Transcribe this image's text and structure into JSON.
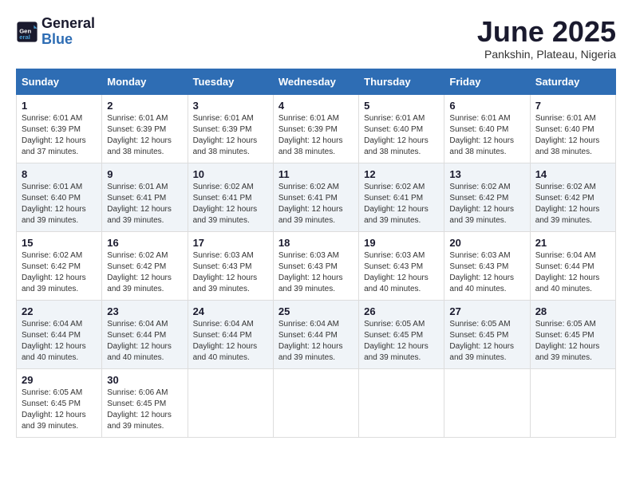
{
  "logo": {
    "line1": "General",
    "line2": "Blue"
  },
  "title": "June 2025",
  "subtitle": "Pankshin, Plateau, Nigeria",
  "weekdays": [
    "Sunday",
    "Monday",
    "Tuesday",
    "Wednesday",
    "Thursday",
    "Friday",
    "Saturday"
  ],
  "weeks": [
    [
      {
        "day": "1",
        "info": "Sunrise: 6:01 AM\nSunset: 6:39 PM\nDaylight: 12 hours\nand 37 minutes."
      },
      {
        "day": "2",
        "info": "Sunrise: 6:01 AM\nSunset: 6:39 PM\nDaylight: 12 hours\nand 38 minutes."
      },
      {
        "day": "3",
        "info": "Sunrise: 6:01 AM\nSunset: 6:39 PM\nDaylight: 12 hours\nand 38 minutes."
      },
      {
        "day": "4",
        "info": "Sunrise: 6:01 AM\nSunset: 6:39 PM\nDaylight: 12 hours\nand 38 minutes."
      },
      {
        "day": "5",
        "info": "Sunrise: 6:01 AM\nSunset: 6:40 PM\nDaylight: 12 hours\nand 38 minutes."
      },
      {
        "day": "6",
        "info": "Sunrise: 6:01 AM\nSunset: 6:40 PM\nDaylight: 12 hours\nand 38 minutes."
      },
      {
        "day": "7",
        "info": "Sunrise: 6:01 AM\nSunset: 6:40 PM\nDaylight: 12 hours\nand 38 minutes."
      }
    ],
    [
      {
        "day": "8",
        "info": "Sunrise: 6:01 AM\nSunset: 6:40 PM\nDaylight: 12 hours\nand 39 minutes."
      },
      {
        "day": "9",
        "info": "Sunrise: 6:01 AM\nSunset: 6:41 PM\nDaylight: 12 hours\nand 39 minutes."
      },
      {
        "day": "10",
        "info": "Sunrise: 6:02 AM\nSunset: 6:41 PM\nDaylight: 12 hours\nand 39 minutes."
      },
      {
        "day": "11",
        "info": "Sunrise: 6:02 AM\nSunset: 6:41 PM\nDaylight: 12 hours\nand 39 minutes."
      },
      {
        "day": "12",
        "info": "Sunrise: 6:02 AM\nSunset: 6:41 PM\nDaylight: 12 hours\nand 39 minutes."
      },
      {
        "day": "13",
        "info": "Sunrise: 6:02 AM\nSunset: 6:42 PM\nDaylight: 12 hours\nand 39 minutes."
      },
      {
        "day": "14",
        "info": "Sunrise: 6:02 AM\nSunset: 6:42 PM\nDaylight: 12 hours\nand 39 minutes."
      }
    ],
    [
      {
        "day": "15",
        "info": "Sunrise: 6:02 AM\nSunset: 6:42 PM\nDaylight: 12 hours\nand 39 minutes."
      },
      {
        "day": "16",
        "info": "Sunrise: 6:02 AM\nSunset: 6:42 PM\nDaylight: 12 hours\nand 39 minutes."
      },
      {
        "day": "17",
        "info": "Sunrise: 6:03 AM\nSunset: 6:43 PM\nDaylight: 12 hours\nand 39 minutes."
      },
      {
        "day": "18",
        "info": "Sunrise: 6:03 AM\nSunset: 6:43 PM\nDaylight: 12 hours\nand 39 minutes."
      },
      {
        "day": "19",
        "info": "Sunrise: 6:03 AM\nSunset: 6:43 PM\nDaylight: 12 hours\nand 40 minutes."
      },
      {
        "day": "20",
        "info": "Sunrise: 6:03 AM\nSunset: 6:43 PM\nDaylight: 12 hours\nand 40 minutes."
      },
      {
        "day": "21",
        "info": "Sunrise: 6:04 AM\nSunset: 6:44 PM\nDaylight: 12 hours\nand 40 minutes."
      }
    ],
    [
      {
        "day": "22",
        "info": "Sunrise: 6:04 AM\nSunset: 6:44 PM\nDaylight: 12 hours\nand 40 minutes."
      },
      {
        "day": "23",
        "info": "Sunrise: 6:04 AM\nSunset: 6:44 PM\nDaylight: 12 hours\nand 40 minutes."
      },
      {
        "day": "24",
        "info": "Sunrise: 6:04 AM\nSunset: 6:44 PM\nDaylight: 12 hours\nand 40 minutes."
      },
      {
        "day": "25",
        "info": "Sunrise: 6:04 AM\nSunset: 6:44 PM\nDaylight: 12 hours\nand 39 minutes."
      },
      {
        "day": "26",
        "info": "Sunrise: 6:05 AM\nSunset: 6:45 PM\nDaylight: 12 hours\nand 39 minutes."
      },
      {
        "day": "27",
        "info": "Sunrise: 6:05 AM\nSunset: 6:45 PM\nDaylight: 12 hours\nand 39 minutes."
      },
      {
        "day": "28",
        "info": "Sunrise: 6:05 AM\nSunset: 6:45 PM\nDaylight: 12 hours\nand 39 minutes."
      }
    ],
    [
      {
        "day": "29",
        "info": "Sunrise: 6:05 AM\nSunset: 6:45 PM\nDaylight: 12 hours\nand 39 minutes."
      },
      {
        "day": "30",
        "info": "Sunrise: 6:06 AM\nSunset: 6:45 PM\nDaylight: 12 hours\nand 39 minutes."
      },
      null,
      null,
      null,
      null,
      null
    ]
  ]
}
